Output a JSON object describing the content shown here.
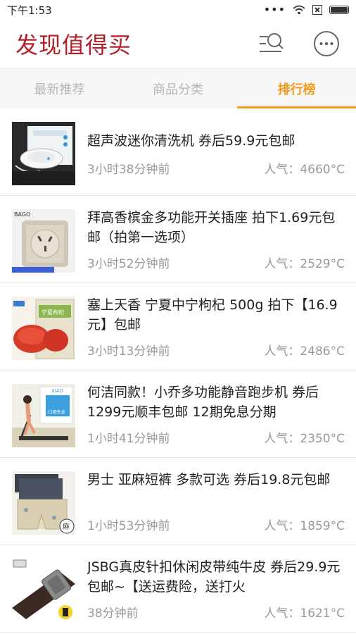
{
  "status": {
    "time": "下午1:53",
    "dots": "•••"
  },
  "header": {
    "title": "发现值得买"
  },
  "tabs": [
    {
      "label": "最新推荐"
    },
    {
      "label": "商品分类"
    },
    {
      "label": "排行榜"
    }
  ],
  "items": [
    {
      "title": "超声波迷你清洗机 券后59.9元包邮",
      "time": "3小时38分钟前",
      "popularity": "人气：4660°C"
    },
    {
      "title": "拜高香槟金多功能开关插座 拍下1.69元包邮（拍第一选项）",
      "time": "3小时52分钟前",
      "popularity": "人气：2529°C",
      "thumb_brand": "BAGO"
    },
    {
      "title": "塞上天香 宁夏中宁枸杞 500g 拍下【16.9元】包邮",
      "time": "3小时13分钟前",
      "popularity": "人气：2486°C",
      "thumb_label": "宁夏枸杞"
    },
    {
      "title": "何洁同款！小乔多功能静音跑步机 券后1299元顺丰包邮 12期免息分期",
      "time": "1小时41分钟前",
      "popularity": "人气：2350°C",
      "thumb_brand": "XIAO",
      "thumb_badge": "12期免息"
    },
    {
      "title": "男士 亚麻短裤 多款可选 券后19.8元包邮",
      "time": "1小时53分钟前",
      "popularity": "人气：1859°C",
      "thumb_badge": "麻"
    },
    {
      "title": "JSBG真皮针扣休闲皮带纯牛皮 券后29.9元包邮~【送运费险，送打火",
      "time": "38分钟前",
      "popularity": "人气：1621°C"
    }
  ],
  "colors": {
    "brand_red": "#b4202a",
    "accent_orange": "#f29b1d",
    "muted_gray": "#999999"
  }
}
